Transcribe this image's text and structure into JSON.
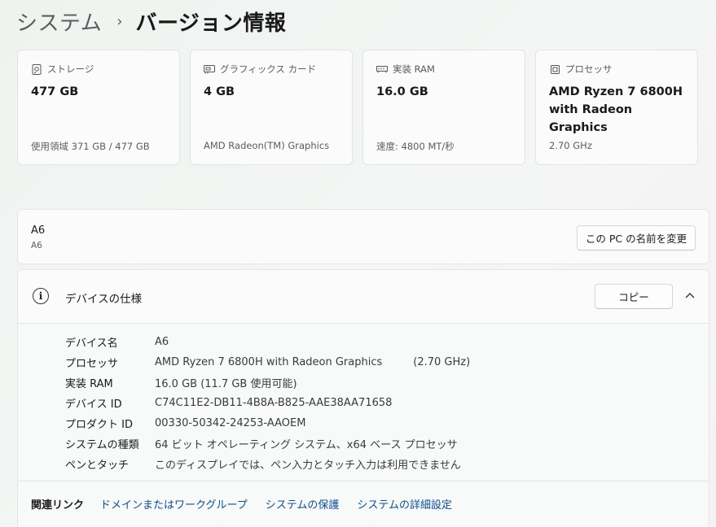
{
  "breadcrumb": {
    "parent": "システム",
    "separator": "›",
    "current": "バージョン情報"
  },
  "cards": [
    {
      "icon": "storage-icon",
      "label": "ストレージ",
      "value": "477 GB",
      "sub": "使用領域 371 GB / 477 GB"
    },
    {
      "icon": "graphics-card-icon",
      "label": "グラフィックス カード",
      "value": "4 GB",
      "sub": "AMD Radeon(TM) Graphics"
    },
    {
      "icon": "memory-icon",
      "label": "実装 RAM",
      "value": "16.0 GB",
      "sub": "速度: 4800 MT/秒"
    },
    {
      "icon": "processor-icon",
      "label": "プロセッサ",
      "value": "AMD Ryzen 7 6800H with Radeon Graphics",
      "sub": "2.70 GHz"
    }
  ],
  "rename": {
    "device_name": "A6",
    "device_subname": "A6",
    "button_label": "この PC の名前を変更"
  },
  "specs": {
    "title": "デバイスの仕様",
    "copy_label": "コピー",
    "rows": [
      {
        "key": "デバイス名",
        "value": "A6",
        "extra": ""
      },
      {
        "key": "プロセッサ",
        "value": "AMD Ryzen 7 6800H with Radeon Graphics",
        "extra": "(2.70 GHz)"
      },
      {
        "key": "実装 RAM",
        "value": "16.0 GB (11.7 GB 使用可能)",
        "extra": ""
      },
      {
        "key": "デバイス ID",
        "value": "C74C11E2-DB11-4B8A-B825-AAE38AA71658",
        "extra": ""
      },
      {
        "key": "プロダクト ID",
        "value": "00330-50342-24253-AAOEM",
        "extra": ""
      },
      {
        "key": "システムの種類",
        "value": "64 ビット オペレーティング システム、x64 ベース プロセッサ",
        "extra": ""
      },
      {
        "key": "ペンとタッチ",
        "value": "このディスプレイでは、ペン入力とタッチ入力は利用できません",
        "extra": ""
      }
    ]
  },
  "related": {
    "label": "関連リンク",
    "links": [
      "ドメインまたはワークグループ",
      "システムの保護",
      "システムの詳細設定"
    ]
  },
  "colors": {
    "link": "#0a4f9e",
    "card_bg": "#fbfbfb"
  }
}
